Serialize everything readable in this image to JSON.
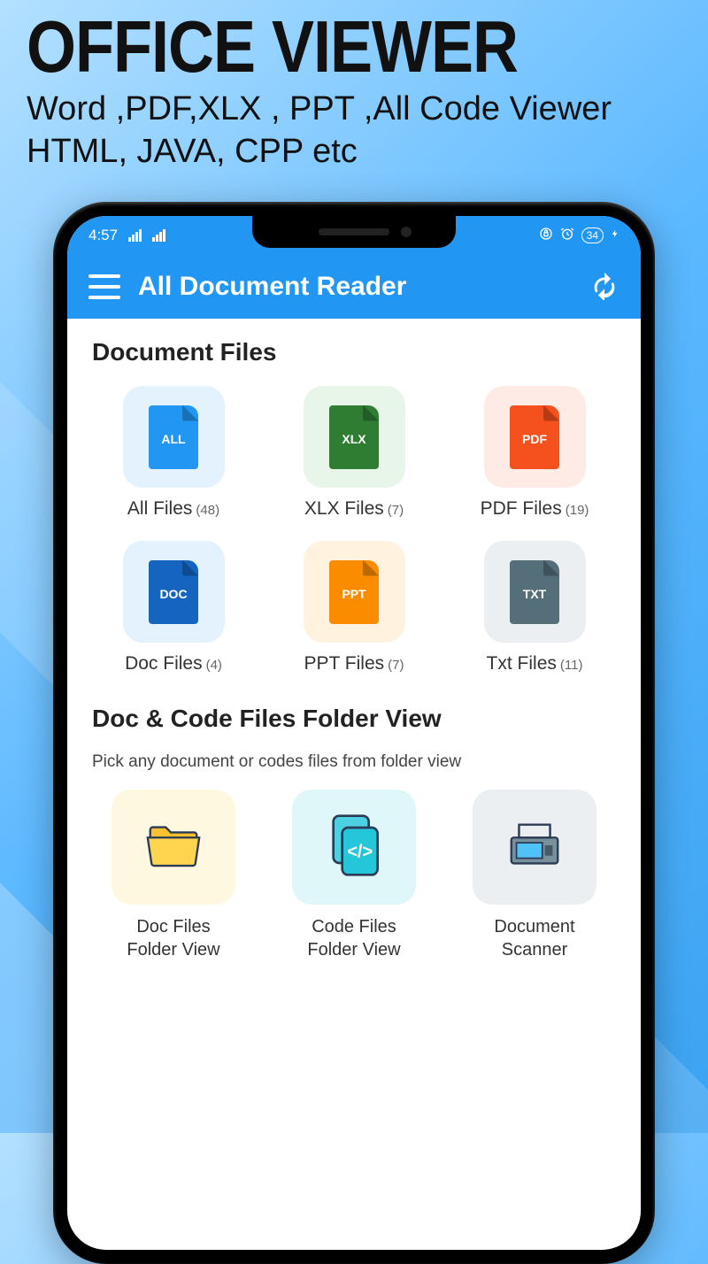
{
  "promo": {
    "title": "OFFICE VIEWER",
    "subtitle": "Word ,PDF,XLX , PPT ,All Code Viewer HTML, JAVA, CPP etc"
  },
  "status_bar": {
    "time": "4:57",
    "battery": "34"
  },
  "app_bar": {
    "title": "All Document Reader"
  },
  "sections": {
    "documents": {
      "title": "Document Files",
      "tiles": [
        {
          "ext": "ALL",
          "label": "All Files",
          "count": "(48)",
          "bg": "#e3f2fd",
          "color": "#2196f3"
        },
        {
          "ext": "XLX",
          "label": "XLX Files",
          "count": "(7)",
          "bg": "#e8f5e9",
          "color": "#2e7d32"
        },
        {
          "ext": "PDF",
          "label": "PDF Files",
          "count": "(19)",
          "bg": "#ffebe6",
          "color": "#f4511e"
        },
        {
          "ext": "DOC",
          "label": "Doc Files",
          "count": "(4)",
          "bg": "#e3f2fd",
          "color": "#1565c0"
        },
        {
          "ext": "PPT",
          "label": "PPT Files",
          "count": "(7)",
          "bg": "#fff3e0",
          "color": "#fb8c00"
        },
        {
          "ext": "TXT",
          "label": "Txt Files",
          "count": "(11)",
          "bg": "#eceff1",
          "color": "#546e7a"
        }
      ]
    },
    "folder_view": {
      "title": "Doc & Code Files Folder View",
      "subtitle": "Pick any document or codes files from folder view",
      "tiles": [
        {
          "label_line1": "Doc Files",
          "label_line2": "Folder View",
          "bg": "#fff8e1",
          "icon": "folder"
        },
        {
          "label_line1": "Code Files",
          "label_line2": "Folder View",
          "bg": "#e0f7fa",
          "icon": "code"
        },
        {
          "label_line1": "Document",
          "label_line2": "Scanner",
          "bg": "#eceff1",
          "icon": "scanner"
        }
      ]
    }
  }
}
